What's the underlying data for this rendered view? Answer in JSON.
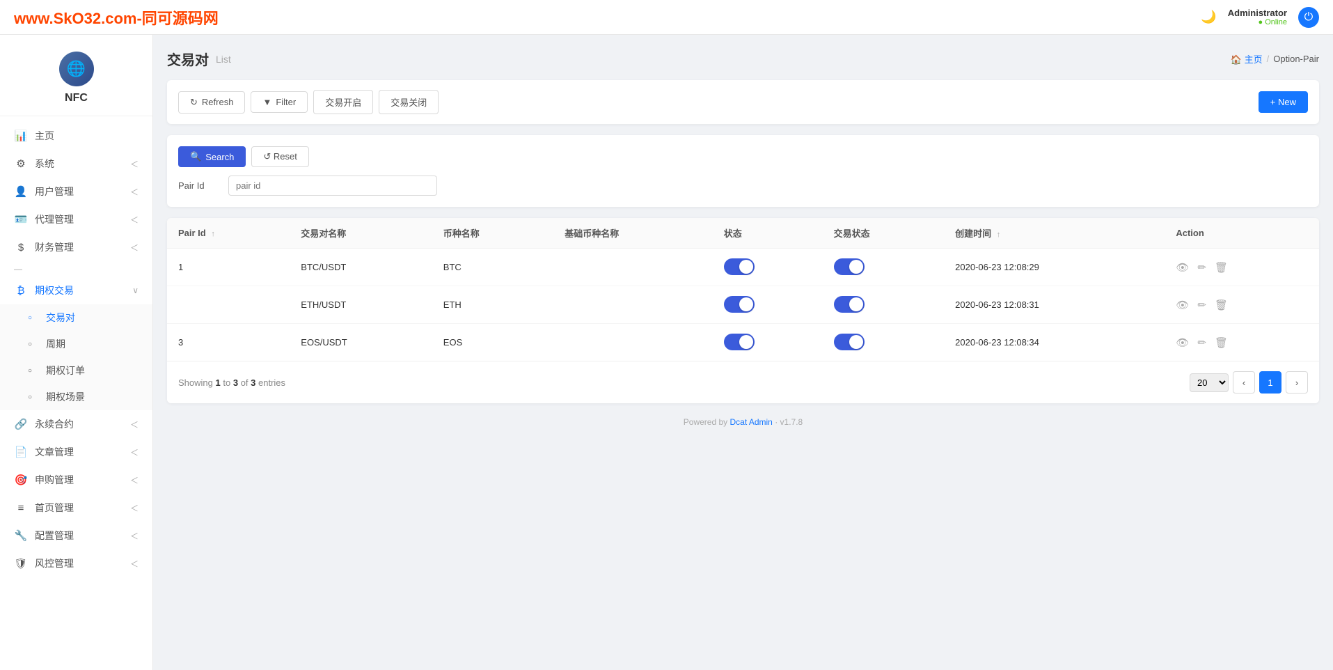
{
  "topbar": {
    "brand": "www.SkO32.com-同可源码网",
    "moon_icon": "🌙",
    "username": "Administrator",
    "status": "● Online",
    "power_icon": "⏻"
  },
  "breadcrumb": {
    "home_label": "🏠 主页",
    "separator": "/",
    "current": "Option-Pair"
  },
  "page": {
    "title": "交易对",
    "subtitle": "List"
  },
  "toolbar": {
    "refresh_label": "Refresh",
    "filter_label": "Filter",
    "open_label": "交易开启",
    "close_label": "交易关闭",
    "new_label": "+ New"
  },
  "filter": {
    "search_label": "Search",
    "reset_label": "↺ Reset",
    "pair_id_label": "Pair Id",
    "pair_id_placeholder": "pair id"
  },
  "table": {
    "columns": [
      "Pair Id",
      "交易对名称",
      "币种名称",
      "基础币种名称",
      "状态",
      "交易状态",
      "创建时间",
      "Action"
    ],
    "rows": [
      {
        "pair_id": "1",
        "pair_name": "BTC/USDT",
        "coin_name": "BTC",
        "base_coin": "",
        "status_on": true,
        "trade_on": true,
        "created_at": "2020-06-23 12:08:29"
      },
      {
        "pair_id": "",
        "pair_name": "ETH/USDT",
        "coin_name": "ETH",
        "base_coin": "",
        "status_on": true,
        "trade_on": true,
        "created_at": "2020-06-23 12:08:31"
      },
      {
        "pair_id": "3",
        "pair_name": "EOS/USDT",
        "coin_name": "EOS",
        "base_coin": "",
        "status_on": true,
        "trade_on": true,
        "created_at": "2020-06-23 12:08:34"
      }
    ]
  },
  "pagination": {
    "showing_prefix": "Showing",
    "from": "1",
    "to": "3",
    "total": "3",
    "entries_label": "entries",
    "page_size": "20",
    "current_page": "1"
  },
  "sidebar": {
    "logo_text": "NFC",
    "items": [
      {
        "icon": "📊",
        "label": "主页",
        "arrow": false,
        "active": false
      },
      {
        "icon": "⚙",
        "label": "系统",
        "arrow": true,
        "active": false
      },
      {
        "icon": "👤",
        "label": "用户管理",
        "arrow": true,
        "active": false
      },
      {
        "icon": "🪪",
        "label": "代理管理",
        "arrow": true,
        "active": false
      },
      {
        "icon": "$",
        "label": "财务管理",
        "arrow": true,
        "active": false
      },
      {
        "icon": "—",
        "label": "",
        "divider": true
      },
      {
        "icon": "₿",
        "label": "期权交易",
        "arrow": true,
        "active": true,
        "expanded": true
      }
    ],
    "submenu": [
      {
        "label": "交易对",
        "active": true
      },
      {
        "label": "周期",
        "active": false
      },
      {
        "label": "期权订单",
        "active": false
      },
      {
        "label": "期权场景",
        "active": false
      }
    ],
    "items2": [
      {
        "icon": "🔗",
        "label": "永续合约",
        "arrow": true
      },
      {
        "icon": "📄",
        "label": "文章管理",
        "arrow": true
      },
      {
        "icon": "🎯",
        "label": "申购管理",
        "arrow": true
      },
      {
        "icon": "≡",
        "label": "首页管理",
        "arrow": true
      },
      {
        "icon": "🔧",
        "label": "配置管理",
        "arrow": true
      },
      {
        "icon": "🛡",
        "label": "风控管理",
        "arrow": true
      }
    ]
  },
  "footer": {
    "powered_by": "Powered by",
    "link_text": "Dcat Admin",
    "version": "· v1.7.8"
  }
}
